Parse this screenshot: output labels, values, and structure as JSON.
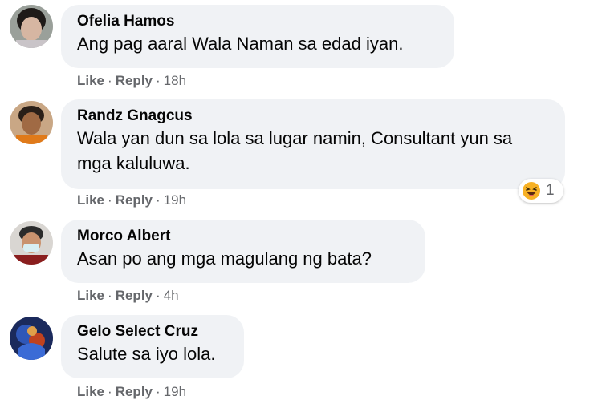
{
  "comments": [
    {
      "author": "Ofelia Hamos",
      "text": "Ang pag aaral Wala Naman sa edad iyan.",
      "like": "Like",
      "reply": "Reply",
      "time": "18h"
    },
    {
      "author": "Randz Gnagcus",
      "text": "Wala yan dun sa lola sa lugar namin, Consultant yun sa mga kaluluwa.",
      "like": "Like",
      "reply": "Reply",
      "time": "19h",
      "reaction_icon": "haha-emoji-icon",
      "reaction_count": "1"
    },
    {
      "author": "Morco Albert",
      "text": "Asan po ang mga magulang ng bata?",
      "like": "Like",
      "reply": "Reply",
      "time": "4h"
    },
    {
      "author": "Gelo Select Cruz",
      "text": "Salute sa iyo lola.",
      "like": "Like",
      "reply": "Reply",
      "time": "19h"
    }
  ],
  "separator": "·",
  "colors": {
    "bubble": "#f0f2f5",
    "meta": "#65676b",
    "text": "#050505",
    "haha": "#f7b125"
  }
}
